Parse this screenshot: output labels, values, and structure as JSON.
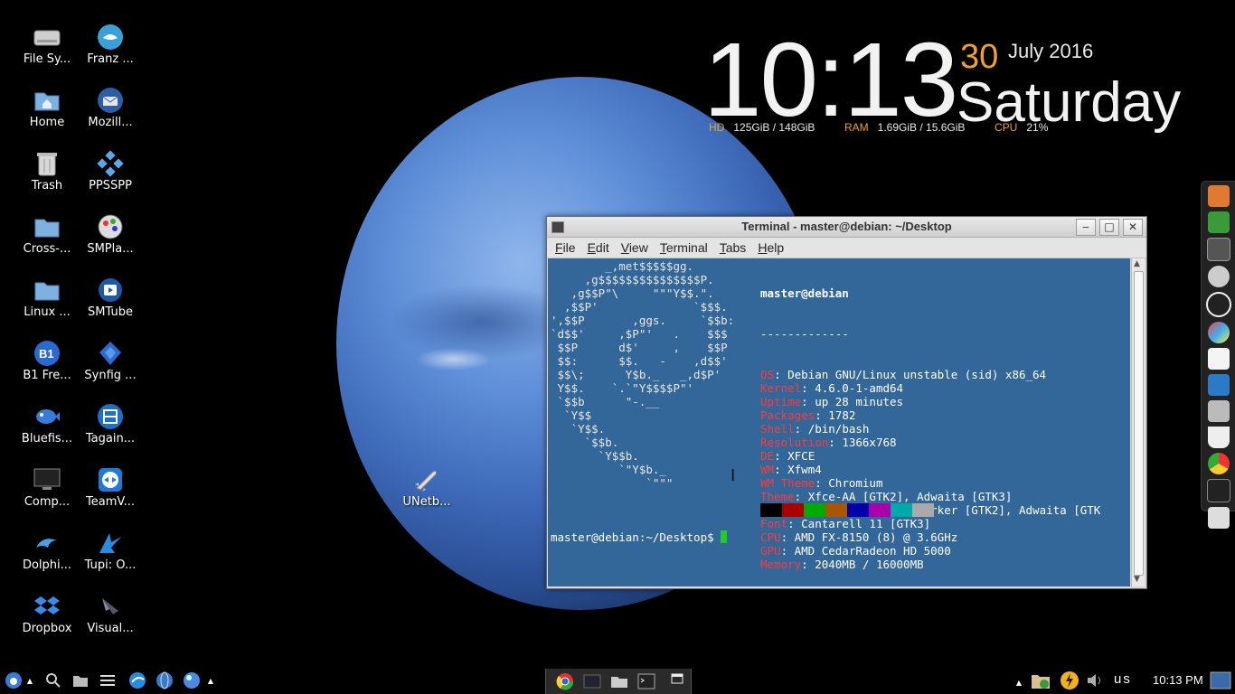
{
  "desktop": {
    "icons": [
      {
        "label": "File Sy...",
        "icon": "drive-icon"
      },
      {
        "label": "Franz ...",
        "icon": "franz-icon"
      },
      {
        "label": "Home",
        "icon": "home-folder-icon"
      },
      {
        "label": "Mozill...",
        "icon": "thunderbird-icon"
      },
      {
        "label": "Trash",
        "icon": "trash-icon"
      },
      {
        "label": "PPSSPP",
        "icon": "ppsspp-icon"
      },
      {
        "label": "Cross-...",
        "icon": "folder-icon"
      },
      {
        "label": "SMPla...",
        "icon": "smplayer-icon"
      },
      {
        "label": "Linux ...",
        "icon": "folder-icon"
      },
      {
        "label": "SMTube",
        "icon": "smtube-icon"
      },
      {
        "label": "B1 Fre...",
        "icon": "b1-icon"
      },
      {
        "label": "Synfig ...",
        "icon": "synfig-icon"
      },
      {
        "label": "Bluefis...",
        "icon": "bluefish-icon"
      },
      {
        "label": "Tagain...",
        "icon": "tagainijisho-icon"
      },
      {
        "label": "Comp...",
        "icon": "computer-icon"
      },
      {
        "label": "TeamV...",
        "icon": "teamviewer-icon"
      },
      {
        "label": "Dolphi...",
        "icon": "dolphin-icon"
      },
      {
        "label": "Tupi: O...",
        "icon": "tupi-icon"
      },
      {
        "label": "Dropbox",
        "icon": "dropbox-icon"
      },
      {
        "label": "Visual...",
        "icon": "visual-icon"
      },
      {
        "label": "UNetb...",
        "icon": "unetbootin-icon"
      }
    ]
  },
  "clock_widget": {
    "time": "10:13",
    "day": "30",
    "month_year": "July 2016",
    "weekday": "Saturday",
    "hd_label": "HD",
    "hd_value": "125GiB / 148GiB",
    "ram_label": "RAM",
    "ram_value": "1.69GiB / 15.6GiB",
    "cpu_label": "CPU",
    "cpu_value": "21%"
  },
  "terminal": {
    "title": "Terminal - master@debian: ~/Desktop",
    "menu": [
      "File",
      "Edit",
      "View",
      "Terminal",
      "Tabs",
      "Help"
    ],
    "header": "master@debian",
    "separator": "-------------",
    "info": [
      {
        "key": "OS",
        "value": "Debian GNU/Linux unstable (sid) x86_64"
      },
      {
        "key": "Kernel",
        "value": "4.6.0-1-amd64"
      },
      {
        "key": "Uptime",
        "value": "up 28 minutes"
      },
      {
        "key": "Packages",
        "value": "1782"
      },
      {
        "key": "Shell",
        "value": "/bin/bash"
      },
      {
        "key": "Resolution",
        "value": "1366x768"
      },
      {
        "key": "DE",
        "value": "XFCE"
      },
      {
        "key": "WM",
        "value": "Xfwm4"
      },
      {
        "key": "WM Theme",
        "value": "Chromium"
      },
      {
        "key": "Theme",
        "value": "Xfce-AA [GTK2], Adwaita [GTK3]"
      },
      {
        "key": "Icons",
        "value": "Elementary-xfce-darker [GTK2], Adwaita [GTK"
      },
      {
        "key": "Font",
        "value": "Cantarell 11 [GTK3]"
      },
      {
        "key": "CPU",
        "value": "AMD FX-8150 (8) @ 3.6GHz"
      },
      {
        "key": "GPU",
        "value": "AMD CedarRadeon HD 5000"
      },
      {
        "key": "Memory",
        "value": "2040MB / 16000MB"
      }
    ],
    "ascii_art": [
      "        _,met$$$$$gg.",
      "     ,g$$$$$$$$$$$$$$$P.",
      "   ,g$$P\"\\     \"\"\"Y$$.\".",
      "  ,$$P'              `$$$.",
      "',$$P       ,ggs.     `$$b:",
      "`d$$'     ,$P\"'   .    $$$",
      " $$P      d$'     ,    $$P",
      " $$:      $$.   -    ,d$$'",
      " $$\\;      Y$b._   _,d$P'",
      " Y$$.    `.`\"Y$$$$P\"'",
      " `$$b      \"-.__",
      "  `Y$$",
      "   `Y$$.",
      "     `$$b.",
      "       `Y$$b.",
      "          `\"Y$b._",
      "              `\"\"\""
    ],
    "palette": [
      "#000000",
      "#aa0000",
      "#00aa00",
      "#aa5500",
      "#0000aa",
      "#aa00aa",
      "#00aaaa",
      "#aaaaaa"
    ],
    "prompt": "master@debian:~/Desktop$ "
  },
  "dock": {
    "items": [
      "anchor-icon",
      "download-icon",
      "calculator-icon",
      "alien-icon",
      "owl-icon",
      "color-picker-icon",
      "document-icon",
      "monitor-icon",
      "folder-icon",
      "coffee-icon",
      "chrome-icon",
      "terminal-icon",
      "trash-icon"
    ]
  },
  "panel": {
    "clock": "10:13 PM",
    "keyboard_layout": "us",
    "launchers": [
      "menu-icon",
      "search-icon",
      "files-icon",
      "list-icon",
      "browser-icon",
      "globe-icon",
      "web-icon"
    ],
    "tasks": [
      "chrome-icon",
      "screen-icon",
      "folder-icon",
      "terminal-icon",
      "window-icon"
    ],
    "tray": [
      "updates-icon",
      "power-icon",
      "volume-icon",
      "desktop-icon"
    ]
  }
}
